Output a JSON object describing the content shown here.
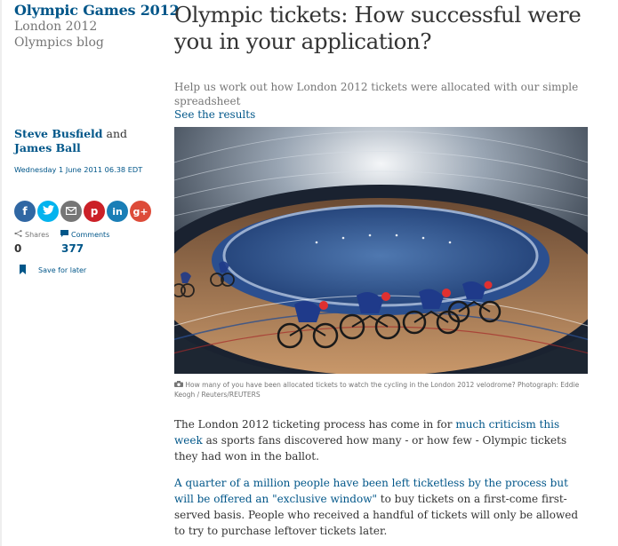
{
  "series": {
    "title": "Olympic Games 2012",
    "subtitle": "London 2012 Olympics blog"
  },
  "byline": {
    "author1": "Steve Busfield",
    "conjunction": "and",
    "author2": "James Ball",
    "date": "Wednesday 1 June 2011 06.38 EDT"
  },
  "share_buttons": [
    {
      "icon": "facebook-icon",
      "glyph": "f",
      "color": "#3067a3"
    },
    {
      "icon": "twitter-icon",
      "glyph": "t",
      "color": "#03b3ee"
    },
    {
      "icon": "email-icon",
      "glyph": "@",
      "color": "#767676"
    },
    {
      "icon": "pinterest-icon",
      "glyph": "p",
      "color": "#cb2027"
    },
    {
      "icon": "linkedin-icon",
      "glyph": "in",
      "color": "#1a7eb6"
    },
    {
      "icon": "google-plus-icon",
      "glyph": "g+",
      "color": "#dd4b39"
    }
  ],
  "stats": {
    "shares_label": "Shares",
    "shares_count": "0",
    "comments_label": "Comments",
    "comments_count": "377"
  },
  "save_for_later": "Save for later",
  "article": {
    "headline": "Olympic tickets: How successful were you in your application?",
    "standfirst": "Help us work out how London 2012 tickets were allocated with our simple spreadsheet",
    "standfirst_link": "See the results",
    "caption": "How many of you have been allocated tickets to watch the cycling in the London 2012 velodrome? Photograph: Eddie Keogh / Reuters/REUTERS",
    "para1_text_a": "The London 2012 ticketing process has come in for ",
    "para1_link": "much criticism this week",
    "para1_text_b": " as sports fans discovered how many - or how few - Olympic tickets they had won in the ballot.",
    "para2_link": "A quarter of a million people have been left ticketless by the process but will be offered an \"exclusive window\"",
    "para2_text": " to buy tickets on a first-come first-served basis. People who received a handful of tickets will only be allowed to try to purchase leftover tickets later."
  },
  "colors": {
    "brand_blue": "#005689",
    "text": "#333333",
    "muted": "#767676"
  }
}
